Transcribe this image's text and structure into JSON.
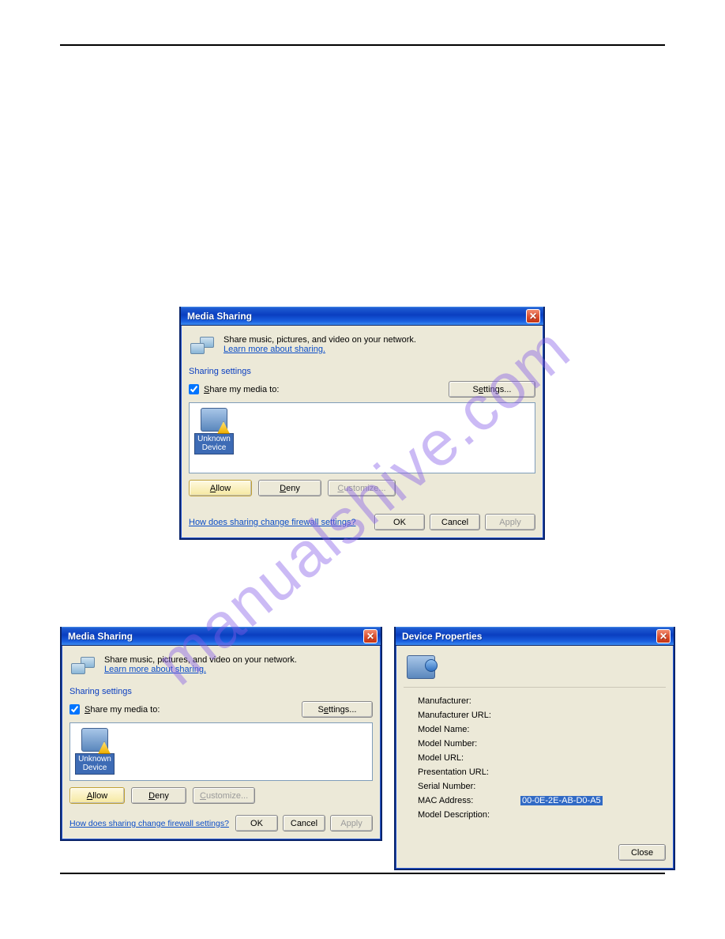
{
  "watermark": "manualshive.com",
  "dialogs": {
    "mediaSharing": {
      "title": "Media Sharing",
      "intro": "Share music, pictures, and video on your network.",
      "learnLink": "Learn more about sharing.",
      "groupLabel": "Sharing settings",
      "checkboxLabel": "Share my media to:",
      "checkboxUnderline": "S",
      "settingsBtn": "Settings...",
      "settingsUnderlineLetter": "e",
      "device": {
        "label1": "Unknown",
        "label2": "Device"
      },
      "allowBtn": "Allow",
      "allowUnderline": "A",
      "denyBtn": "Deny",
      "denyUnderline": "D",
      "customizeBtn": "Customize...",
      "customizeUnderline": "C",
      "firewallLink": "How does sharing change firewall settings?",
      "okBtn": "OK",
      "cancelBtn": "Cancel",
      "applyBtn": "Apply"
    },
    "deviceProps": {
      "title": "Device Properties",
      "fields": {
        "manufacturer": "Manufacturer:",
        "manufacturerUrl": "Manufacturer URL:",
        "modelName": "Model Name:",
        "modelNumber": "Model Number:",
        "modelUrl": "Model URL:",
        "presentationUrl": "Presentation URL:",
        "serialNumber": "Serial Number:",
        "macAddress": "MAC Address:",
        "modelDescription": "Model Description:"
      },
      "macValue": "00-0E-2E-AB-D0-A5",
      "closeBtn": "Close"
    }
  }
}
